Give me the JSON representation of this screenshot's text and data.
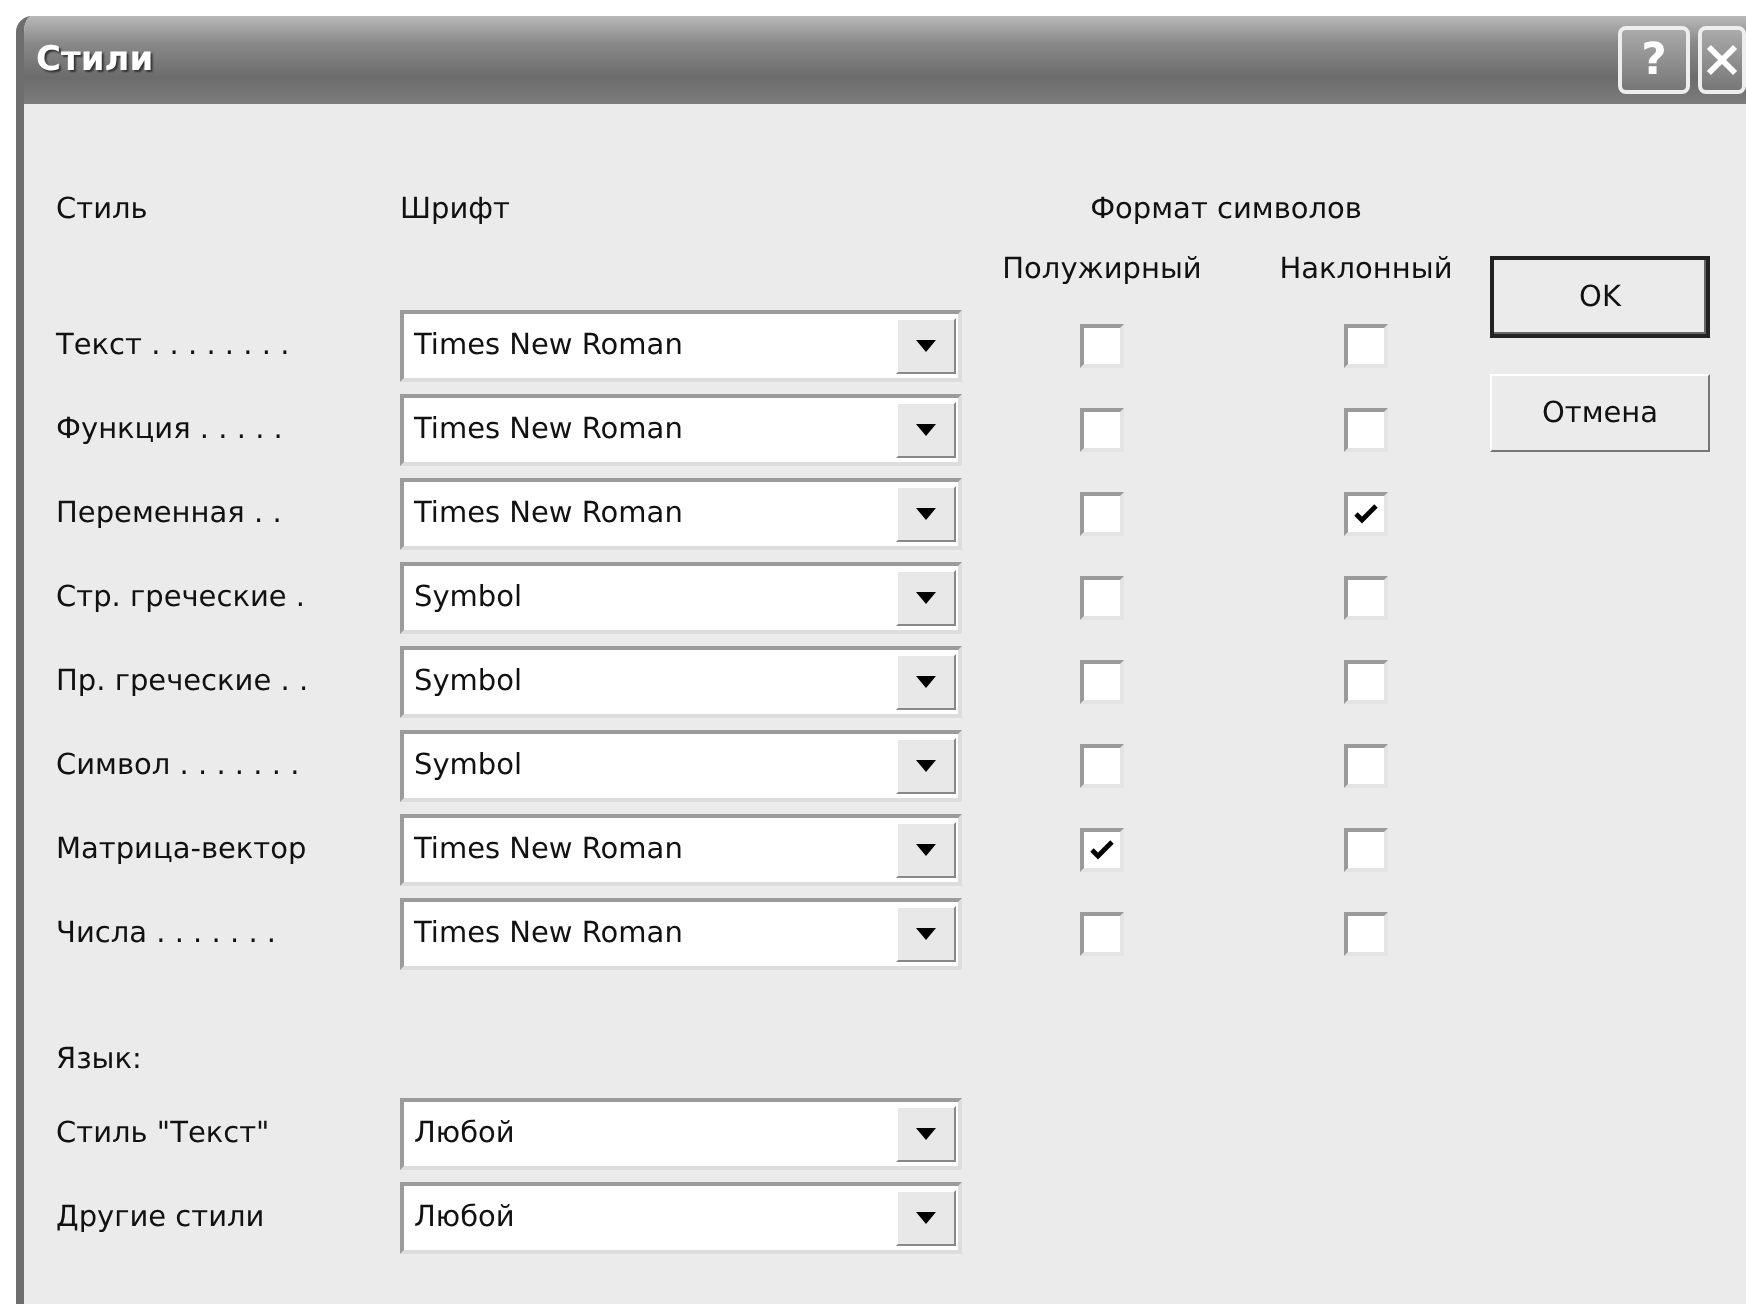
{
  "window": {
    "title": "Стили",
    "help": "?"
  },
  "headers": {
    "style": "Стиль",
    "font": "Шрифт",
    "format": "Формат символов",
    "bold": "Полужирный",
    "italic": "Наклонный"
  },
  "rows": [
    {
      "style": "Текст . . . . . . . .",
      "font": "Times New Roman",
      "bold": false,
      "italic": false
    },
    {
      "style": "Функция  . . . . .",
      "font": "Times New Roman",
      "bold": false,
      "italic": false
    },
    {
      "style": "Переменная . .",
      "font": "Times New Roman",
      "bold": false,
      "italic": true
    },
    {
      "style": "Стр. греческие .",
      "font": "Symbol",
      "bold": false,
      "italic": false
    },
    {
      "style": "Пр. греческие . .",
      "font": "Symbol",
      "bold": false,
      "italic": false
    },
    {
      "style": "Символ . . . . . . .",
      "font": "Symbol",
      "bold": false,
      "italic": false
    },
    {
      "style": "Матрица-вектор",
      "font": "Times New Roman",
      "bold": true,
      "italic": false
    },
    {
      "style": "Числа . . . . . . .",
      "font": "Times New Roman",
      "bold": false,
      "italic": false
    }
  ],
  "language": {
    "label": "Язык:",
    "rows": [
      {
        "label": "Стиль \"Текст\"",
        "value": "Любой"
      },
      {
        "label": "Другие стили",
        "value": "Любой"
      }
    ]
  },
  "buttons": [
    {
      "label": "OK",
      "default": true
    },
    {
      "label": "Отмена",
      "default": false
    }
  ]
}
